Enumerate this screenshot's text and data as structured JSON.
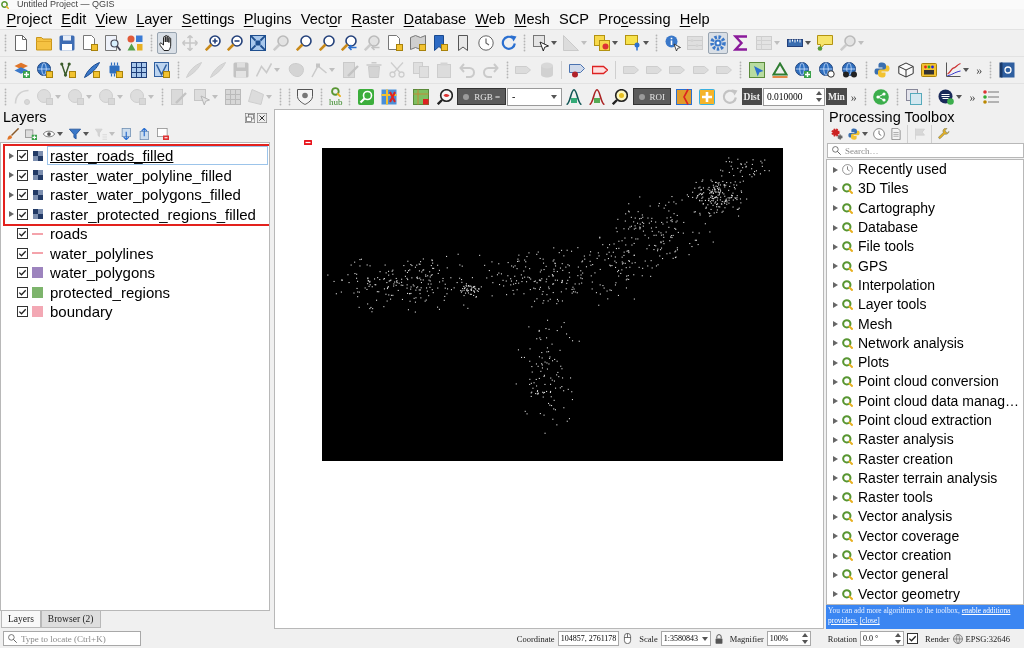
{
  "window": {
    "title": "Untitled Project — QGIS"
  },
  "menu_bar": [
    {
      "key": "P",
      "post": "roject"
    },
    {
      "key": "E",
      "post": "dit"
    },
    {
      "key": "V",
      "post": "iew"
    },
    {
      "key": "L",
      "post": "ayer"
    },
    {
      "key": "S",
      "post": "ettings"
    },
    {
      "key": "P",
      "post": "lugins"
    },
    {
      "pre": "Vect",
      "key": "o",
      "post": "r"
    },
    {
      "key": "R",
      "post": "aster"
    },
    {
      "key": "D",
      "post": "atabase"
    },
    {
      "key": "W",
      "post": "eb"
    },
    {
      "key": "M",
      "post": "esh"
    },
    {
      "pre": "SCP"
    },
    {
      "pre": "Pro",
      "key": "c",
      "post": "essing"
    },
    {
      "key": "H",
      "post": "elp"
    }
  ],
  "toolbars": [
    [
      {
        "kind": "handle"
      },
      {
        "kind": "button",
        "disabled": false,
        "selected": false
      },
      {
        "kind": "button",
        "disabled": false,
        "selected": false
      },
      {
        "kind": "button",
        "disabled": false,
        "selected": false
      },
      {
        "kind": "button",
        "disabled": false,
        "selected": false
      },
      {
        "kind": "button",
        "disabled": false,
        "selected": false
      },
      {
        "kind": "button",
        "disabled": false,
        "selected": false
      },
      {
        "kind": "handle"
      },
      {
        "kind": "button",
        "disabled": false,
        "selected": true
      },
      {
        "kind": "button",
        "disabled": true,
        "selected": false
      },
      {
        "kind": "button",
        "disabled": false,
        "selected": false
      },
      {
        "kind": "button",
        "disabled": false,
        "selected": false
      },
      {
        "kind": "button",
        "disabled": false,
        "selected": false
      },
      {
        "kind": "button",
        "disabled": true,
        "selected": false
      },
      {
        "kind": "button",
        "disabled": false,
        "selected": false
      },
      {
        "kind": "button",
        "disabled": false,
        "selected": false
      },
      {
        "kind": "button",
        "disabled": false,
        "selected": false
      },
      {
        "kind": "button",
        "disabled": true,
        "selected": false
      },
      {
        "kind": "button",
        "disabled": false,
        "selected": false
      },
      {
        "kind": "button",
        "disabled": false,
        "selected": false
      },
      {
        "kind": "button",
        "disabled": false,
        "selected": false
      },
      {
        "kind": "button",
        "disabled": false,
        "selected": false
      },
      {
        "kind": "button",
        "disabled": false,
        "selected": false
      },
      {
        "kind": "button",
        "disabled": false,
        "selected": false
      },
      {
        "kind": "handle"
      },
      {
        "kind": "button",
        "disabled": false,
        "selected": false,
        "menu": true
      },
      {
        "kind": "button",
        "disabled": true,
        "selected": false,
        "menu": true
      },
      {
        "kind": "button",
        "disabled": false,
        "selected": false,
        "menu": true
      },
      {
        "kind": "button",
        "disabled": false,
        "selected": false,
        "menu": true
      },
      {
        "kind": "handle"
      },
      {
        "kind": "button",
        "disabled": false,
        "selected": false
      },
      {
        "kind": "button",
        "disabled": true,
        "selected": false
      },
      {
        "kind": "button",
        "disabled": false,
        "selected": true
      },
      {
        "kind": "button",
        "disabled": false,
        "selected": false
      },
      {
        "kind": "button",
        "disabled": true,
        "selected": false,
        "menu": true
      },
      {
        "kind": "button",
        "disabled": false,
        "selected": false,
        "menu": true
      },
      {
        "kind": "button",
        "disabled": false,
        "selected": false
      },
      {
        "kind": "button",
        "disabled": true,
        "selected": false,
        "menu": true
      }
    ],
    [
      {
        "kind": "handle"
      },
      {
        "kind": "button",
        "disabled": false,
        "selected": false
      },
      {
        "kind": "button",
        "disabled": false,
        "selected": false
      },
      {
        "kind": "button",
        "disabled": false,
        "selected": false
      },
      {
        "kind": "button",
        "disabled": false,
        "selected": false
      },
      {
        "kind": "button",
        "disabled": false,
        "selected": false
      },
      {
        "kind": "button",
        "disabled": false,
        "selected": false
      },
      {
        "kind": "button",
        "disabled": false,
        "selected": false
      },
      {
        "kind": "handle"
      },
      {
        "kind": "button",
        "disabled": true,
        "selected": false
      },
      {
        "kind": "button",
        "disabled": true,
        "selected": false
      },
      {
        "kind": "button",
        "disabled": true,
        "selected": false
      },
      {
        "kind": "button",
        "disabled": true,
        "selected": false,
        "menu": true
      },
      {
        "kind": "button",
        "disabled": true,
        "selected": false
      },
      {
        "kind": "button",
        "disabled": true,
        "selected": false,
        "menu": true
      },
      {
        "kind": "button",
        "disabled": true,
        "selected": false
      },
      {
        "kind": "button",
        "disabled": true,
        "selected": false
      },
      {
        "kind": "button",
        "disabled": true,
        "selected": false
      },
      {
        "kind": "button",
        "disabled": true,
        "selected": false
      },
      {
        "kind": "button",
        "disabled": true,
        "selected": false
      },
      {
        "kind": "button",
        "disabled": true,
        "selected": false
      },
      {
        "kind": "button",
        "disabled": true,
        "selected": false
      },
      {
        "kind": "handle"
      },
      {
        "kind": "button",
        "disabled": true,
        "selected": false
      },
      {
        "kind": "button",
        "disabled": true,
        "selected": false
      },
      {
        "kind": "separator"
      },
      {
        "kind": "button",
        "disabled": false,
        "selected": false
      },
      {
        "kind": "button",
        "disabled": false,
        "selected": false
      },
      {
        "kind": "separator"
      },
      {
        "kind": "button",
        "disabled": true,
        "selected": false
      },
      {
        "kind": "button",
        "disabled": true,
        "selected": false
      },
      {
        "kind": "button",
        "disabled": true,
        "selected": false
      },
      {
        "kind": "button",
        "disabled": true,
        "selected": false
      },
      {
        "kind": "button",
        "disabled": true,
        "selected": false
      },
      {
        "kind": "handle"
      },
      {
        "kind": "button",
        "disabled": false,
        "selected": false
      },
      {
        "kind": "button",
        "disabled": false,
        "selected": false
      },
      {
        "kind": "button",
        "disabled": false,
        "selected": false
      },
      {
        "kind": "button",
        "disabled": false,
        "selected": false
      },
      {
        "kind": "button",
        "disabled": false,
        "selected": false
      },
      {
        "kind": "handle"
      },
      {
        "kind": "button",
        "disabled": false,
        "selected": false
      },
      {
        "kind": "button",
        "disabled": false,
        "selected": false
      },
      {
        "kind": "button",
        "disabled": false,
        "selected": false
      },
      {
        "kind": "button",
        "disabled": false,
        "selected": false,
        "menu": true
      },
      {
        "kind": "overflow",
        "label": "»"
      },
      {
        "kind": "handle"
      },
      {
        "kind": "button",
        "disabled": false,
        "selected": false
      }
    ],
    [
      {
        "kind": "handle"
      },
      {
        "kind": "button",
        "disabled": true,
        "selected": false
      },
      {
        "kind": "button",
        "disabled": true,
        "selected": false,
        "menu": true
      },
      {
        "kind": "button",
        "disabled": true,
        "selected": false,
        "menu": true
      },
      {
        "kind": "button",
        "disabled": true,
        "selected": false,
        "menu": true
      },
      {
        "kind": "button",
        "disabled": true,
        "selected": false,
        "menu": true
      },
      {
        "kind": "handle"
      },
      {
        "kind": "button",
        "disabled": true,
        "selected": false
      },
      {
        "kind": "button",
        "disabled": true,
        "selected": false,
        "menu": true
      },
      {
        "kind": "button",
        "disabled": true,
        "selected": false
      },
      {
        "kind": "button",
        "disabled": true,
        "selected": false,
        "menu": true
      },
      {
        "kind": "handle"
      },
      {
        "kind": "handle"
      },
      {
        "kind": "button",
        "disabled": false,
        "selected": false
      },
      {
        "kind": "handle"
      },
      {
        "kind": "hub",
        "label": "hub"
      },
      {
        "kind": "handle"
      },
      {
        "kind": "button",
        "disabled": false,
        "selected": false
      },
      {
        "kind": "button",
        "disabled": false,
        "selected": false
      },
      {
        "kind": "handle"
      },
      {
        "kind": "button",
        "disabled": false,
        "selected": false
      },
      {
        "kind": "button",
        "disabled": false,
        "selected": false
      },
      {
        "kind": "dark-combo",
        "label": "RGB ="
      },
      {
        "kind": "combo",
        "label": "-"
      },
      {
        "kind": "button",
        "disabled": false,
        "selected": false
      },
      {
        "kind": "button",
        "disabled": false,
        "selected": false
      },
      {
        "kind": "button",
        "disabled": false,
        "selected": false
      },
      {
        "kind": "dark-button",
        "label": "ROI"
      },
      {
        "kind": "button",
        "disabled": false,
        "selected": false
      },
      {
        "kind": "button",
        "disabled": false,
        "selected": false
      },
      {
        "kind": "button",
        "disabled": true,
        "selected": false
      },
      {
        "kind": "dark-label",
        "label": "Dist"
      },
      {
        "kind": "spin",
        "label": "0.010000"
      },
      {
        "kind": "dark-label",
        "label": "Min"
      },
      {
        "kind": "overflow",
        "label": "»"
      },
      {
        "kind": "handle"
      },
      {
        "kind": "button",
        "disabled": false,
        "selected": false
      },
      {
        "kind": "handle"
      },
      {
        "kind": "button",
        "disabled": false,
        "selected": false
      },
      {
        "kind": "handle"
      },
      {
        "kind": "button",
        "disabled": false,
        "selected": false,
        "menu": true
      },
      {
        "kind": "overflow",
        "label": "»"
      },
      {
        "kind": "button",
        "disabled": false,
        "selected": false
      }
    ]
  ],
  "layers_panel": {
    "title": "Layers",
    "tools": [
      {
        "kind": "button",
        "disabled": false,
        "selected": false
      },
      {
        "kind": "button",
        "disabled": false,
        "selected": false
      },
      {
        "kind": "button",
        "disabled": false,
        "selected": false,
        "menu": true
      },
      {
        "kind": "button",
        "disabled": false,
        "selected": false,
        "menu": true
      },
      {
        "kind": "button",
        "disabled": true,
        "selected": false,
        "menu": true
      },
      {
        "kind": "button",
        "disabled": false,
        "selected": false
      },
      {
        "kind": "button",
        "disabled": false,
        "selected": false
      },
      {
        "kind": "button",
        "disabled": false,
        "selected": false
      }
    ],
    "items": [
      {
        "name": "raster_roads_filled",
        "kind": "raster",
        "expanded": false,
        "checked": true,
        "selected": true,
        "highlighted": true
      },
      {
        "name": "raster_water_polyline_filled",
        "kind": "raster",
        "expanded": false,
        "checked": true,
        "selected": false,
        "highlighted": true
      },
      {
        "name": "raster_water_polygons_filled",
        "kind": "raster",
        "expanded": false,
        "checked": true,
        "selected": false,
        "highlighted": true
      },
      {
        "name": "raster_protected_regions_filled",
        "kind": "raster",
        "expanded": false,
        "checked": true,
        "selected": false,
        "highlighted": true
      },
      {
        "name": "roads",
        "kind": "line",
        "color": "#f4a3ab",
        "checked": true,
        "selected": false,
        "highlighted": false
      },
      {
        "name": "water_polylines",
        "kind": "line",
        "color": "#f4a3ab",
        "checked": true,
        "selected": false,
        "highlighted": false
      },
      {
        "name": "water_polygons",
        "kind": "polygon",
        "color": "#9d84be",
        "checked": true,
        "selected": false,
        "highlighted": false
      },
      {
        "name": "protected_regions",
        "kind": "polygon",
        "color": "#7db46c",
        "checked": true,
        "selected": false,
        "highlighted": false
      },
      {
        "name": "boundary",
        "kind": "polygon",
        "color": "#f3a8b4",
        "checked": true,
        "selected": false,
        "highlighted": false
      }
    ]
  },
  "dock_tabs": [
    {
      "label": "Layers",
      "selected": true
    },
    {
      "label": "Browser (2)",
      "selected": false
    }
  ],
  "processing_toolbox": {
    "title": "Processing Toolbox",
    "tools": [
      {
        "kind": "button",
        "disabled": false,
        "selected": false
      },
      {
        "kind": "button",
        "disabled": false,
        "selected": false,
        "menu": true
      },
      {
        "kind": "button",
        "disabled": false,
        "selected": false
      },
      {
        "kind": "button",
        "disabled": false,
        "selected": false
      },
      {
        "kind": "separator"
      },
      {
        "kind": "button",
        "disabled": true,
        "selected": false
      },
      {
        "kind": "separator"
      },
      {
        "kind": "button",
        "disabled": false,
        "selected": false
      }
    ],
    "search": {
      "placeholder": "Search…"
    },
    "items": [
      {
        "label": "Recently used",
        "kind": "history",
        "expanded": false
      },
      {
        "label": "3D Tiles",
        "kind": "provider",
        "expanded": false
      },
      {
        "label": "Cartography",
        "kind": "provider",
        "expanded": false
      },
      {
        "label": "Database",
        "kind": "provider",
        "expanded": false
      },
      {
        "label": "File tools",
        "kind": "provider",
        "expanded": false
      },
      {
        "label": "GPS",
        "kind": "provider",
        "expanded": false
      },
      {
        "label": "Interpolation",
        "kind": "provider",
        "expanded": false
      },
      {
        "label": "Layer tools",
        "kind": "provider",
        "expanded": false
      },
      {
        "label": "Mesh",
        "kind": "provider",
        "expanded": false
      },
      {
        "label": "Network analysis",
        "kind": "provider",
        "expanded": false
      },
      {
        "label": "Plots",
        "kind": "provider",
        "expanded": false
      },
      {
        "label": "Point cloud conversion",
        "kind": "provider",
        "expanded": false
      },
      {
        "label": "Point cloud data manag…",
        "kind": "provider",
        "expanded": false
      },
      {
        "label": "Point cloud extraction",
        "kind": "provider",
        "expanded": false
      },
      {
        "label": "Raster analysis",
        "kind": "provider",
        "expanded": false
      },
      {
        "label": "Raster creation",
        "kind": "provider",
        "expanded": false
      },
      {
        "label": "Raster terrain analysis",
        "kind": "provider",
        "expanded": false
      },
      {
        "label": "Raster tools",
        "kind": "provider",
        "expanded": false
      },
      {
        "label": "Vector analysis",
        "kind": "provider",
        "expanded": false
      },
      {
        "label": "Vector coverage",
        "kind": "provider",
        "expanded": false
      },
      {
        "label": "Vector creation",
        "kind": "provider",
        "expanded": false
      },
      {
        "label": "Vector general",
        "kind": "provider",
        "expanded": false
      },
      {
        "label": "Vector geometry",
        "kind": "provider",
        "expanded": false
      }
    ],
    "notice": {
      "text": "You can add more algorithms to the toolbox,",
      "link": "enable additiona",
      "link_continued": "providers.",
      "close": "[close]"
    }
  },
  "status_bar": {
    "locator": {
      "placeholder": "Type to locate (Ctrl+K)"
    },
    "coordinate_label": "Coordinate",
    "coordinate": "104857, 2761178",
    "scale_label": "Scale",
    "scale": "1:3580843",
    "magnifier_label": "Magnifier",
    "magnifier": "100%",
    "rotation_label": "Rotation",
    "rotation": "0.0 °",
    "render": {
      "label": "Render",
      "checked": true
    },
    "crs": "EPSG:32646"
  }
}
